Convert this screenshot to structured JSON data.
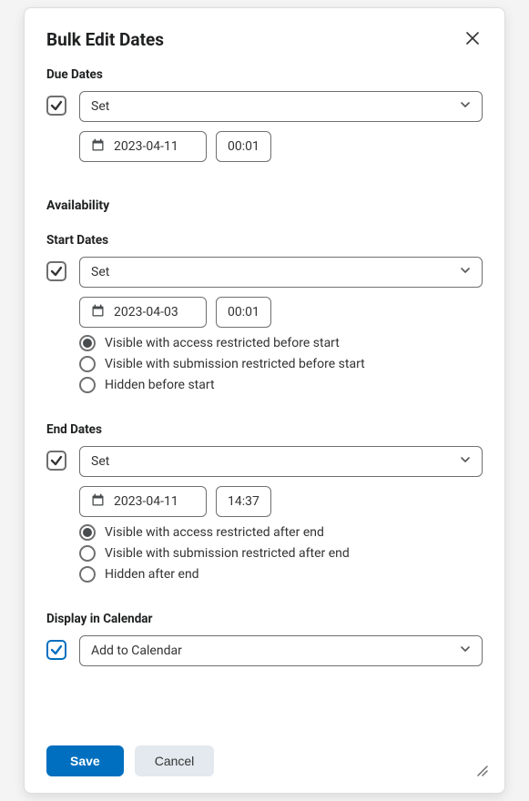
{
  "modal": {
    "title": "Bulk Edit Dates"
  },
  "dueDates": {
    "label": "Due Dates",
    "checked": true,
    "action": "Set",
    "date": "2023-04-11",
    "time": "00:01"
  },
  "availability": {
    "label": "Availability"
  },
  "startDates": {
    "label": "Start Dates",
    "checked": true,
    "action": "Set",
    "date": "2023-04-03",
    "time": "00:01",
    "radios": [
      {
        "label": "Visible with access restricted before start",
        "selected": true
      },
      {
        "label": "Visible with submission restricted before start",
        "selected": false
      },
      {
        "label": "Hidden before start",
        "selected": false
      }
    ]
  },
  "endDates": {
    "label": "End Dates",
    "checked": true,
    "action": "Set",
    "date": "2023-04-11",
    "time": "14:37",
    "radios": [
      {
        "label": "Visible with access restricted after end",
        "selected": true
      },
      {
        "label": "Visible with submission restricted after end",
        "selected": false
      },
      {
        "label": "Hidden after end",
        "selected": false
      }
    ]
  },
  "calendar": {
    "label": "Display in Calendar",
    "checked": true,
    "action": "Add to Calendar"
  },
  "footer": {
    "save": "Save",
    "cancel": "Cancel"
  }
}
